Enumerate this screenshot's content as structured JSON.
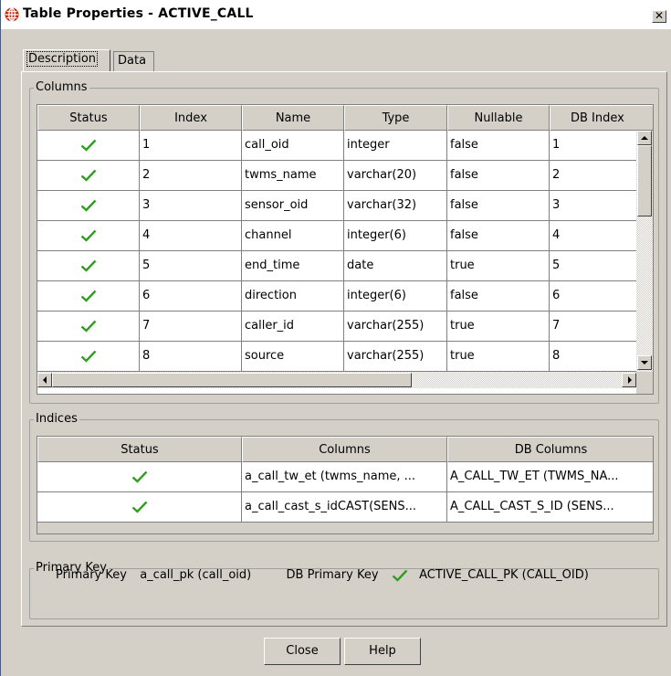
{
  "window": {
    "title": "Table Properties  - ACTIVE_CALL",
    "close_label": "✕"
  },
  "tabs": [
    {
      "label": "Description",
      "active": true
    },
    {
      "label": "Data",
      "active": false
    }
  ],
  "columns_group": {
    "title": "Columns",
    "headers": [
      "Status",
      "Index",
      "Name",
      "Type",
      "Nullable",
      "DB Index"
    ],
    "rows": [
      {
        "status": "check",
        "index": "1",
        "name": "call_oid",
        "type": "integer",
        "nullable": "false",
        "db_index": "1"
      },
      {
        "status": "check",
        "index": "2",
        "name": "twms_name",
        "type": "varchar(20)",
        "nullable": "false",
        "db_index": "2"
      },
      {
        "status": "check",
        "index": "3",
        "name": "sensor_oid",
        "type": "varchar(32)",
        "nullable": "false",
        "db_index": "3"
      },
      {
        "status": "check",
        "index": "4",
        "name": "channel",
        "type": "integer(6)",
        "nullable": "false",
        "db_index": "4"
      },
      {
        "status": "check",
        "index": "5",
        "name": "end_time",
        "type": "date",
        "nullable": "true",
        "db_index": "5"
      },
      {
        "status": "check",
        "index": "6",
        "name": "direction",
        "type": "integer(6)",
        "nullable": "false",
        "db_index": "6"
      },
      {
        "status": "check",
        "index": "7",
        "name": "caller_id",
        "type": "varchar(255)",
        "nullable": "true",
        "db_index": "7"
      },
      {
        "status": "check",
        "index": "8",
        "name": "source",
        "type": "varchar(255)",
        "nullable": "true",
        "db_index": "8"
      }
    ]
  },
  "indices_group": {
    "title": "Indices",
    "headers": [
      "Status",
      "Columns",
      "DB Columns"
    ],
    "rows": [
      {
        "status": "check",
        "columns": "a_call_tw_et (twms_name, ...",
        "db_columns": "A_CALL_TW_ET (TWMS_NA..."
      },
      {
        "status": "check",
        "columns": "a_call_cast_s_idCAST(SENS...",
        "db_columns": "A_CALL_CAST_S_ID (SENS..."
      }
    ]
  },
  "primary_key_group": {
    "title": "Primary Key",
    "pk_label": "Primary Key",
    "pk_value": "a_call_pk (call_oid)",
    "db_pk_label": "DB Primary Key",
    "db_pk_value": "ACTIVE_CALL_PK (CALL_OID)"
  },
  "buttons": {
    "close": "Close",
    "help": "Help"
  },
  "colors": {
    "check_green": "#2e9e1e",
    "title_icon_red": "#cc2200"
  },
  "icons": {
    "title": "table-globe-icon",
    "status": "checkmark-icon"
  }
}
